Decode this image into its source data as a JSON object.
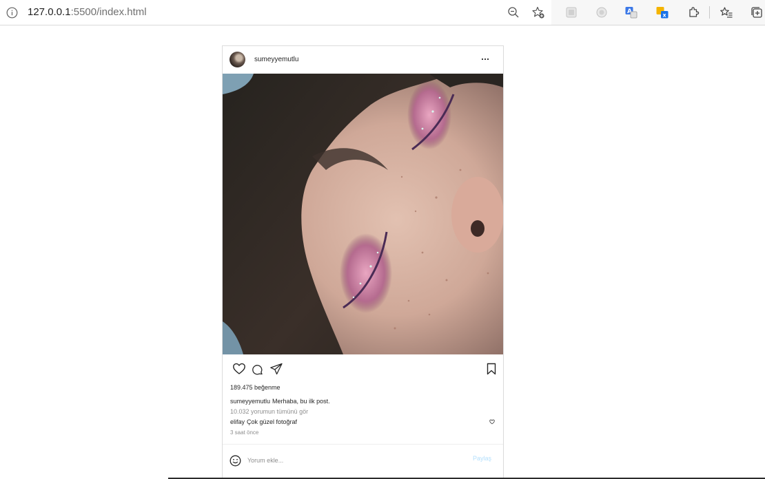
{
  "browser": {
    "url_host": "127.0.0.1",
    "url_rest": ":5500/index.html",
    "icons": [
      "info-icon",
      "zoom-out-icon",
      "add-favorite-icon",
      "extension-icon-1",
      "extension-icon-2",
      "translate-icon",
      "translate-x-icon",
      "extensions-puzzle-icon",
      "favorites-icon",
      "collections-icon"
    ]
  },
  "post": {
    "username": "sumeyyemutlu",
    "more_icon": "more-horizontal-icon",
    "likes": "189.475 beğenme",
    "caption": {
      "user": "sumeyyemutlu",
      "text": "Merhaba, bu ilk post."
    },
    "view_comments": "10.032 yorumun tümünü gör",
    "comment": {
      "user": "elifay",
      "text": "Çok güzel fotoğraf"
    },
    "time_ago": "3 saat önce",
    "add_comment": {
      "placeholder": "Yorum ekle...",
      "button": "Paylaş"
    },
    "action_icons": [
      "heart-icon",
      "comment-icon",
      "share-icon",
      "bookmark-icon"
    ]
  },
  "colors": {
    "border": "#dbdbdb",
    "text": "#262626",
    "muted": "#8e8e8e",
    "post_button_disabled": "#b2dffc"
  }
}
